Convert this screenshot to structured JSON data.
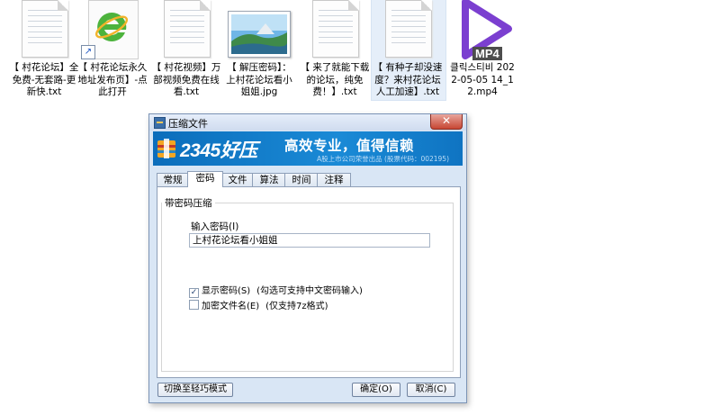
{
  "desktop_files": [
    {
      "name": "【 村花论坛】全免费-无套路-更新快.txt",
      "type": "txt"
    },
    {
      "name": "【 村花论坛永久地址发布页】-点此打开",
      "type": "shortcut"
    },
    {
      "name": "【 村花视频】万部视频免费在线看.txt",
      "type": "txt"
    },
    {
      "name": "【 解压密码】：上村花论坛看小姐姐.jpg",
      "type": "jpg"
    },
    {
      "name": "【 来了就能下载的论坛，纯免费！】.txt",
      "type": "txt"
    },
    {
      "name": "【 有种子却没速度？来村花论坛人工加速】.txt",
      "type": "txt"
    },
    {
      "name": "클릭스티비 2022-05-05 14_12.mp4",
      "type": "mp4"
    }
  ],
  "mp4_badge": "MP4",
  "dialog": {
    "title": "压缩文件",
    "close_label": "✕",
    "banner": {
      "brand": "2345好压",
      "slogan": "高效专业，值得信赖",
      "subline": "A股上市公司荣誉出品 (股票代码：002195)"
    },
    "tabs": [
      "常规",
      "密码",
      "文件",
      "算法",
      "时间",
      "注释"
    ],
    "active_tab": "密码",
    "group_title": "带密码压缩",
    "password_label": "输入密码(I)",
    "password_value": "上村花论坛看小姐姐",
    "show_password": {
      "label": "显示密码(S)",
      "checked": true,
      "hint": "(勾选可支持中文密码输入)"
    },
    "encrypt_names": {
      "label": "加密文件名(E)",
      "checked": false,
      "hint": "(仅支持7z格式)"
    },
    "buttons": {
      "switch_mode": "切换至轻巧模式",
      "ok": "确定(O)",
      "cancel": "取消(C)"
    }
  },
  "colors": {
    "banner": "#1a8ad6",
    "dialog_bg": "#d9e6f5",
    "mp4_play": "#7b3fd0",
    "close": "#c74633"
  }
}
